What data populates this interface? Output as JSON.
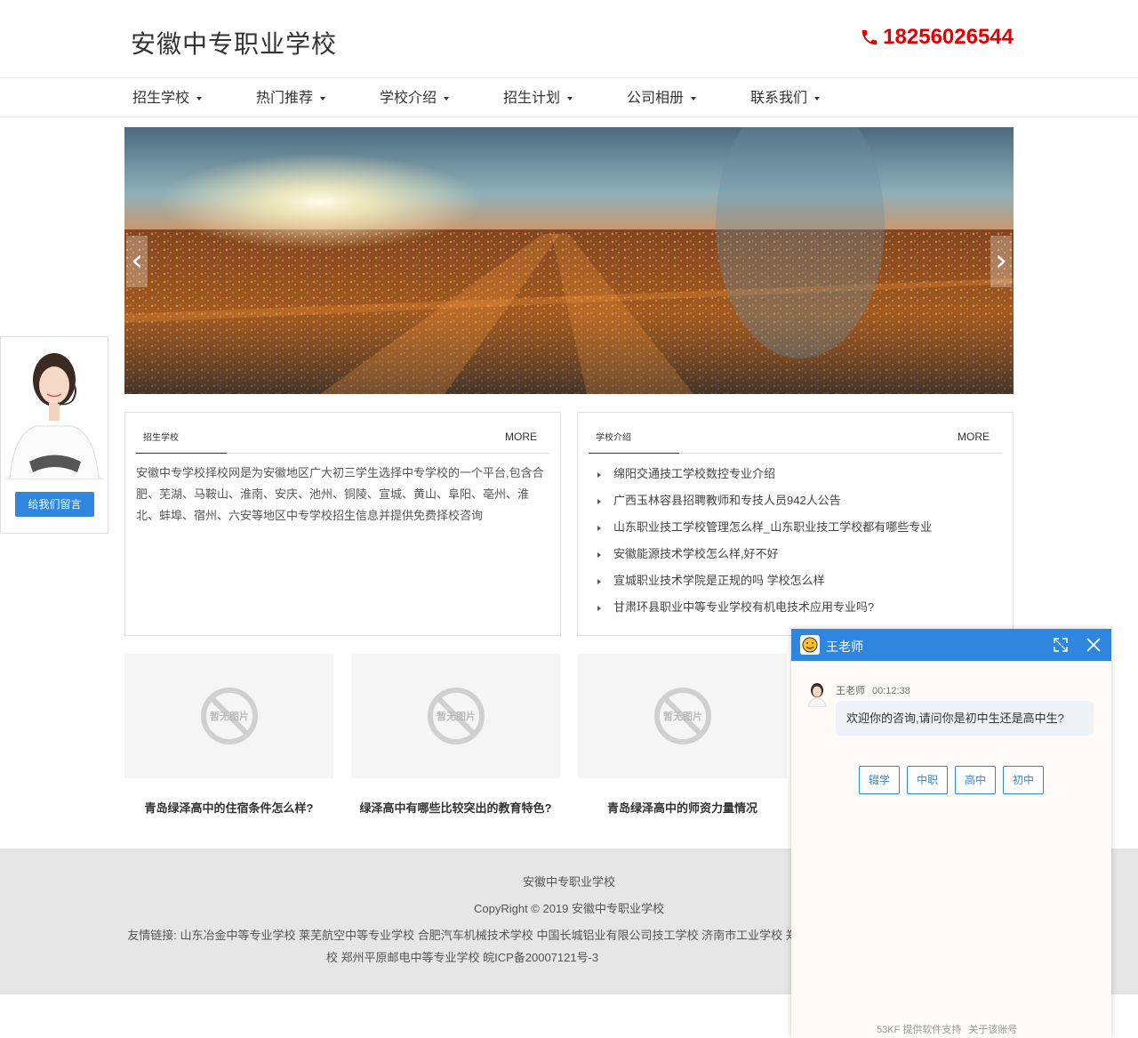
{
  "header": {
    "title": "安徽中专职业学校",
    "phone": "18256026544",
    "phone_color": "#e40000"
  },
  "nav": {
    "items": [
      {
        "label": "招生学校"
      },
      {
        "label": "热门推荐"
      },
      {
        "label": "学校介绍"
      },
      {
        "label": "招生计划"
      },
      {
        "label": "公司相册"
      },
      {
        "label": "联系我们"
      }
    ]
  },
  "banner": {
    "prev_icon": "chevron-left-icon",
    "next_icon": "chevron-right-icon"
  },
  "side_widget": {
    "button_label": "给我们留言"
  },
  "panel_left": {
    "title": "招生学校",
    "more": "MORE",
    "text": "安徽中专学校择校网是为安徽地区广大初三学生选择中专学校的一个平台,包含合肥、芜湖、马鞍山、淮南、安庆、池州、铜陵、宣城、黄山、阜阳、亳州、淮北、蚌埠、宿州、六安等地区中专学校招生信息并提供免费择校咨询"
  },
  "panel_right": {
    "title": "学校介绍",
    "more": "MORE",
    "items": [
      "绵阳交通技工学校数控专业介绍",
      "广西玉林容县招聘教师和专技人员942人公告",
      "山东职业技工学校管理怎么样_山东职业技工学校都有哪些专业",
      "安徽能源技术学校怎么样,好不好",
      "宣城职业技术学院是正规的吗 学校怎么样",
      "甘肃环县职业中等专业学校有机电技术应用专业吗?"
    ]
  },
  "cards": [
    {
      "placeholder": "暂无图片",
      "caption": "青岛绿泽高中的住宿条件怎么样?"
    },
    {
      "placeholder": "暂无图片",
      "caption": "绿泽高中有哪些比较突出的教育特色?"
    },
    {
      "placeholder": "暂无图片",
      "caption": "青岛绿泽高中的师资力量情况"
    }
  ],
  "footer": {
    "name": "安徽中专职业学校",
    "copyright": "CopyRight © 2019 安徽中专职业学校",
    "links_label": "友情链接:",
    "links": [
      "山东冶金中等专业学校",
      "莱芜航空中等专业学校",
      "合肥汽车机械技术学校",
      "中国长城铝业有限公司技工学校",
      "济南市工业学校",
      "郑州平原邮电中等专业学校"
    ],
    "hidden_fragment_1": "郑",
    "hidden_fragment_2": "校",
    "icp": "皖ICP备20007121号-3"
  },
  "chat": {
    "title": "王老师",
    "agent_name": "王老师",
    "time": "00:12:38",
    "message": "欢迎你的咨询,请问你是初中生还是高中生?",
    "options": [
      "辍学",
      "中职",
      "高中",
      "初中"
    ],
    "footer_left": "53KF 提供软件支持",
    "footer_right": "关于该账号",
    "accent": "#2e86de"
  }
}
